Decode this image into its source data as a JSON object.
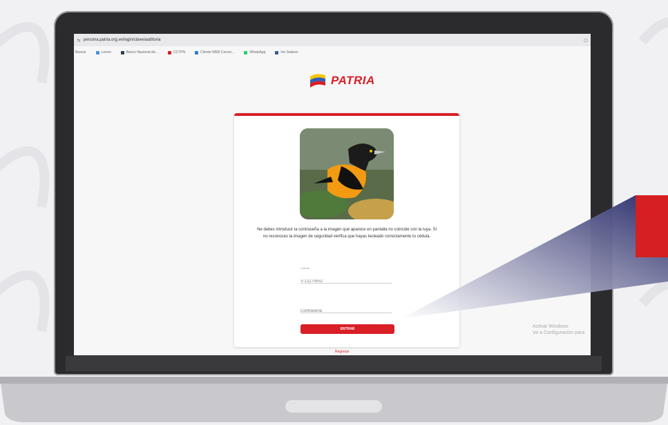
{
  "browser": {
    "url": "persona.patria.org.ve/login/clave/auditoria",
    "bookmarks": [
      {
        "label": "Buscar",
        "color": "#7a7a7a"
      },
      {
        "label": "Lorem",
        "color": "#4a90d9"
      },
      {
        "label": "Banco Nacional de...",
        "color": "#2c3e50"
      },
      {
        "label": "CCTPN",
        "color": "#d81f26"
      },
      {
        "label": "Cliente WEB Correo...",
        "color": "#2e7dd1"
      },
      {
        "label": "WhatsApp",
        "color": "#25d366"
      },
      {
        "label": "Iris Solares",
        "color": "#3b5998"
      }
    ]
  },
  "logo": {
    "text": "PATRIA"
  },
  "login": {
    "instructions": "Ne debes introducir la contraseña a la imagen que aparece en pantalla no coincide con la tuya. Si no reconoces la imagen de seguridad verifica que hayas tecleado correctamente tu cédula.",
    "user_label": "Cédula",
    "user_value": "V-13279652",
    "password_placeholder": "Contraseña",
    "enter_label": "ENTRAR",
    "below_link": "Regresar"
  },
  "watermark": {
    "line1": "Activar Windows",
    "line2": "Ve a Configuración para"
  }
}
